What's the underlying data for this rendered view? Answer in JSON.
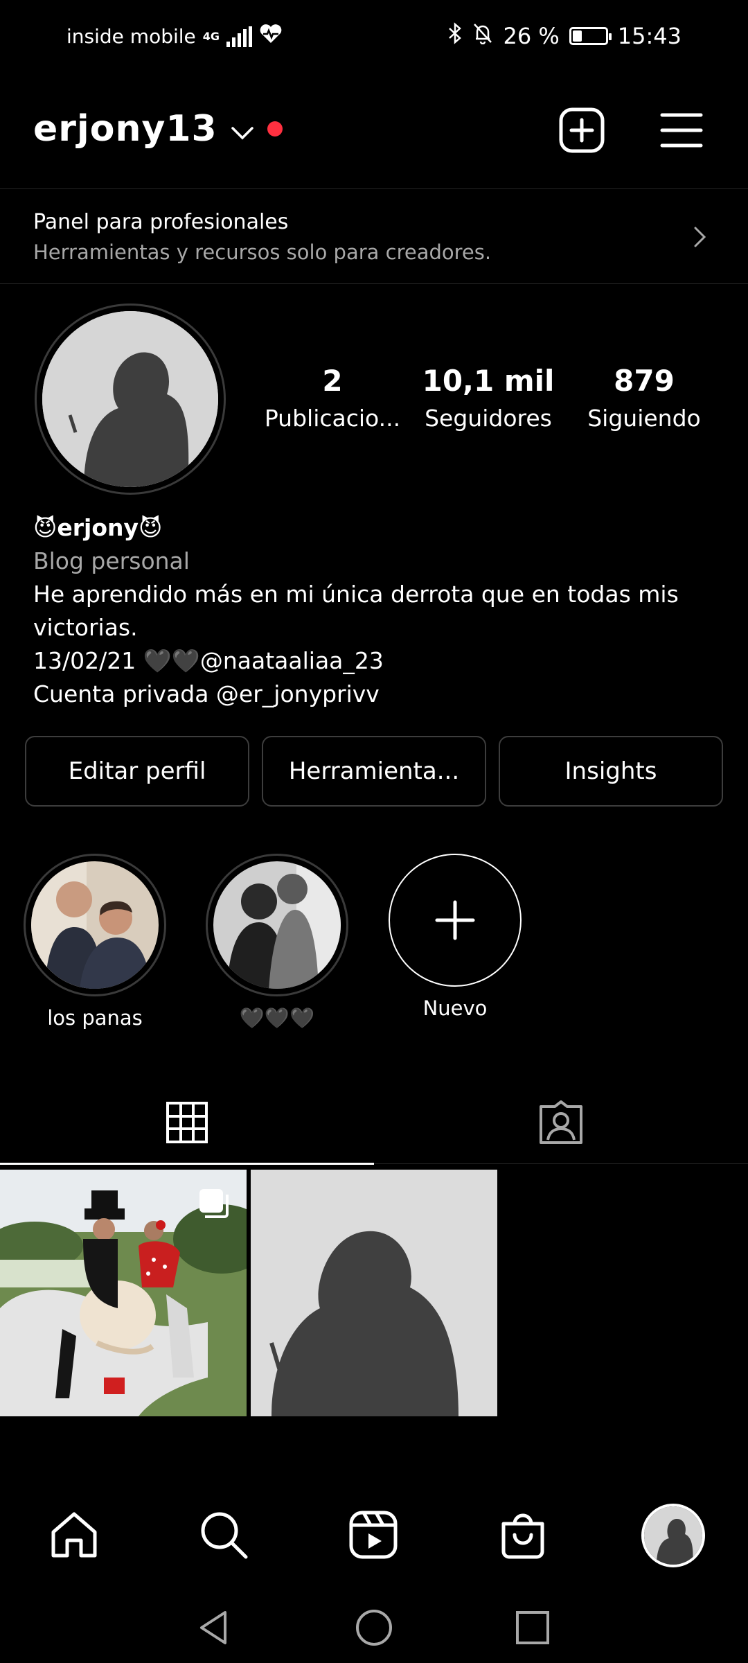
{
  "status_bar": {
    "carrier": "inside mobile",
    "network": "4G",
    "battery_percent": "26 %",
    "battery_level": 0.26,
    "time": "15:43"
  },
  "header": {
    "username": "erjony13",
    "icons": [
      "chevron-down-icon",
      "new-post-icon",
      "menu-icon"
    ]
  },
  "pro_panel": {
    "title": "Panel para profesionales",
    "subtitle": "Herramientas y recursos solo para creadores."
  },
  "profile": {
    "stats": [
      {
        "value": "2",
        "label": "Publicacio..."
      },
      {
        "value": "10,1 mil",
        "label": "Seguidores"
      },
      {
        "value": "879",
        "label": "Siguiendo"
      }
    ],
    "display_name": "😈erjony😈",
    "category": "Blog personal",
    "bio_line1": "He aprendido más en mi única derrota que en todas mis victorias.",
    "bio_line2": "13/02/21 🖤🖤@naataaliaa_23",
    "bio_line3": "Cuenta privada @er_jonyprivv"
  },
  "actions": {
    "edit": "Editar perfil",
    "tools": "Herramienta...",
    "insights": "Insights"
  },
  "highlights": [
    {
      "label": "los panas"
    },
    {
      "label": "🖤🖤🖤"
    },
    {
      "label": "Nuevo"
    }
  ],
  "tabs": [
    "grid-icon",
    "tagged-icon"
  ],
  "bottom_nav": [
    "home-icon",
    "search-icon",
    "reels-icon",
    "shop-icon",
    "profile-avatar"
  ],
  "colors": {
    "background": "#000000",
    "accent_dot": "#ff3040",
    "secondary_text": "#a8a8a8",
    "border": "#3d3d3d"
  }
}
